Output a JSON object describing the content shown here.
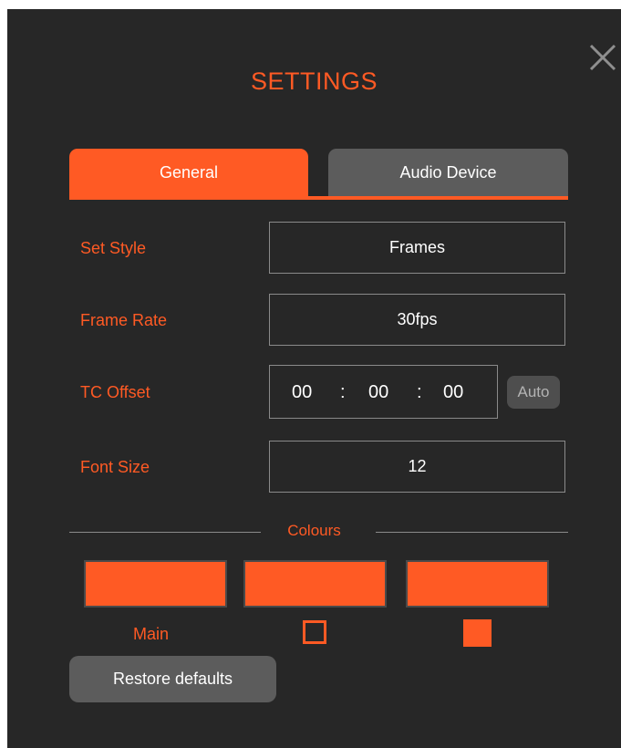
{
  "dialog": {
    "title": "SETTINGS",
    "close_icon": "close-icon"
  },
  "tabs": [
    {
      "label": "General",
      "active": true
    },
    {
      "label": "Audio Device",
      "active": false
    }
  ],
  "settings": {
    "set_style": {
      "label": "Set Style",
      "value": "Frames"
    },
    "frame_rate": {
      "label": "Frame Rate",
      "value": "30fps"
    },
    "tc_offset": {
      "label": "TC Offset",
      "hours": "00",
      "minutes": "00",
      "seconds": "00",
      "separator": ":",
      "auto_label": "Auto"
    },
    "font_size": {
      "label": "Font Size",
      "value": "12"
    }
  },
  "colours": {
    "section_label": "Colours",
    "swatches": [
      {
        "color": "#ff5a24"
      },
      {
        "color": "#ff5a24"
      },
      {
        "color": "#ff5a24"
      }
    ],
    "main_label": "Main",
    "outline_checkbox_checked": false,
    "filled_checkbox_checked": true
  },
  "restore_label": "Restore defaults",
  "theme": {
    "accent": "#ff5a24",
    "background": "#272727",
    "tab_inactive": "#5c5c5c",
    "border": "#8a8a8a"
  }
}
